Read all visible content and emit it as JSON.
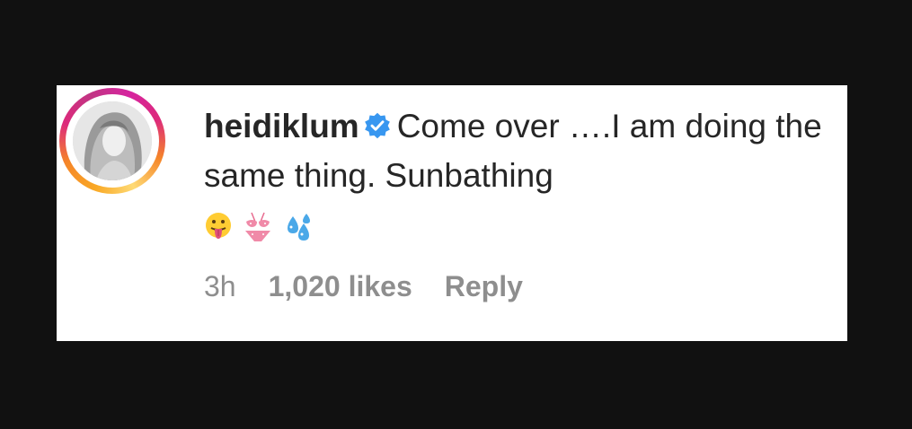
{
  "comment": {
    "username": "heidiklum",
    "verified_icon": "verified-badge-icon",
    "text": "Come over ….I am doing the same thing. Sunbathing",
    "emojis": [
      "face-with-tongue-icon",
      "bikini-icon",
      "sweat-droplets-icon"
    ],
    "time": "3h",
    "likes": "1,020 likes",
    "reply_label": "Reply"
  },
  "colors": {
    "background": "#111111",
    "card": "#ffffff",
    "text": "#262626",
    "meta": "#8e8e8e",
    "verified": "#3897f0"
  }
}
